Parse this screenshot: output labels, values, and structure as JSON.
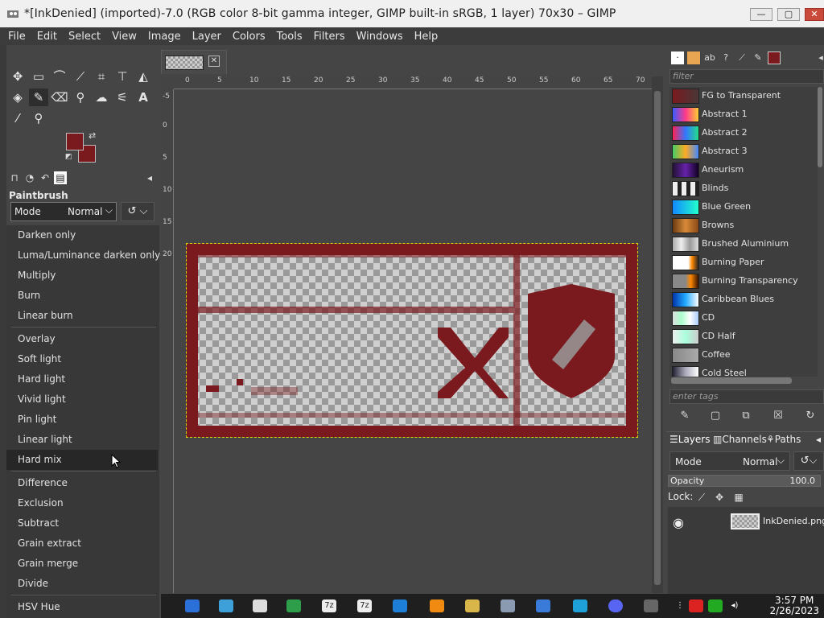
{
  "window": {
    "title": "*[InkDenied] (imported)-7.0 (RGB color 8-bit gamma integer, GIMP built-in sRGB, 1 layer) 70x30 – GIMP",
    "minimize": "—",
    "maximize": "▢",
    "close": "✕"
  },
  "menubar": [
    "File",
    "Edit",
    "Select",
    "View",
    "Image",
    "Layer",
    "Colors",
    "Tools",
    "Filters",
    "Windows",
    "Help"
  ],
  "toolbox": {
    "tool_options_title": "Paintbrush",
    "mode_label": "Mode",
    "mode_value": "Normal",
    "fg_color": "#7a1a1e",
    "bg_color": "#7a1a1e"
  },
  "mode_dropdown": {
    "items": [
      "Darken only",
      "Luma/Luminance darken only",
      "Multiply",
      "Burn",
      "Linear burn",
      "Overlay",
      "Soft light",
      "Hard light",
      "Vivid light",
      "Pin light",
      "Linear light",
      "Hard mix",
      "Difference",
      "Exclusion",
      "Subtract",
      "Grain extract",
      "Grain merge",
      "Divide",
      "HSV Hue"
    ],
    "hovered": "Hard mix"
  },
  "ruler": {
    "h_ticks": [
      "0",
      "5",
      "10",
      "15",
      "20",
      "25",
      "30",
      "35",
      "40",
      "45",
      "50",
      "55",
      "60",
      "65",
      "70"
    ],
    "v_ticks": [
      "-5",
      "0",
      "5",
      "10",
      "15",
      "20"
    ]
  },
  "canvas": {
    "ink_color": "#7a1a1e"
  },
  "gradients": {
    "filter_placeholder": "filter",
    "tags_placeholder": "enter tags",
    "items": [
      {
        "name": "FG to Transparent",
        "swatch": "linear-gradient(90deg,#7a1a1e,rgba(122,26,30,0.2))"
      },
      {
        "name": "Abstract 1",
        "swatch": "linear-gradient(90deg,#3a5cff,#ff3a8a,#ffcc33)"
      },
      {
        "name": "Abstract 2",
        "swatch": "linear-gradient(90deg,#ff2255,#3377ff,#22dd88)"
      },
      {
        "name": "Abstract 3",
        "swatch": "linear-gradient(90deg,#44cc66,#ffaa22,#4488ff)"
      },
      {
        "name": "Aneurism",
        "swatch": "linear-gradient(90deg,#221133,#6622aa,#110022)"
      },
      {
        "name": "Blinds",
        "swatch": "repeating-linear-gradient(90deg,#eee 0 6px,#222 6px 11px)"
      },
      {
        "name": "Blue Green",
        "swatch": "linear-gradient(90deg,#1188ff,#22ffcc)"
      },
      {
        "name": "Browns",
        "swatch": "linear-gradient(90deg,#6b3a12,#d78a38,#8a4a18)"
      },
      {
        "name": "Brushed Aluminium",
        "swatch": "linear-gradient(90deg,#aaa,#eee,#999,#ddd)"
      },
      {
        "name": "Burning Paper",
        "swatch": "linear-gradient(90deg,#fff 60%,#ff8800 75%,#222)"
      },
      {
        "name": "Burning Transparency",
        "swatch": "linear-gradient(90deg,#888 50%,#ff8800 70%,#331100)"
      },
      {
        "name": "Caribbean Blues",
        "swatch": "linear-gradient(90deg,#0033aa,#22aaff,#ffffff)"
      },
      {
        "name": "CD",
        "swatch": "linear-gradient(90deg,#ddd,#aaffcc,#fff,#aaccff)"
      },
      {
        "name": "CD Half",
        "swatch": "linear-gradient(90deg,#eee,#aaffdd,#ccc)"
      },
      {
        "name": "Coffee",
        "swatch": "linear-gradient(90deg,#888,#aaa)"
      },
      {
        "name": "Cold Steel",
        "swatch": "linear-gradient(90deg,#223,#aab,#fff)"
      }
    ]
  },
  "layers": {
    "tabs": [
      "Layers",
      "Channels",
      "Paths"
    ],
    "mode_label": "Mode",
    "mode_value": "Normal",
    "opacity_label": "Opacity",
    "opacity_value": "100.0",
    "lock_label": "Lock:",
    "layer_name": "InkDenied.png"
  },
  "taskbar": {
    "time": "3:57 PM",
    "date": "2/26/2023"
  }
}
